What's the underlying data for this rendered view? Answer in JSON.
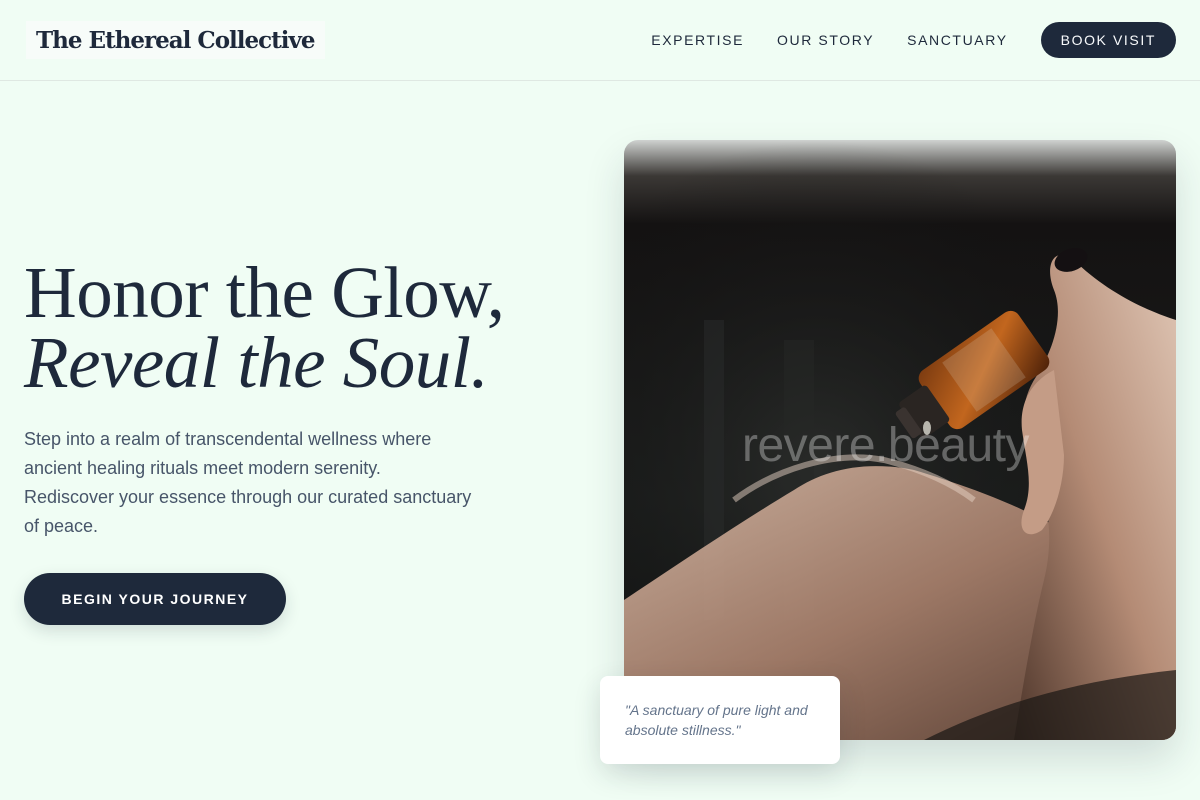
{
  "brand": {
    "name": "The Ethereal Collective"
  },
  "nav": {
    "links": [
      "EXPERTISE",
      "OUR STORY",
      "SANCTUARY"
    ],
    "cta_label": "BOOK VISIT"
  },
  "hero": {
    "headline_line1": "Honor the Glow,",
    "headline_line2": "Reveal the Soul.",
    "lead": "Step into a realm of transcendental wellness where ancient healing rituals meet modern serenity. Rediscover your essence through our curated sanctuary of peace.",
    "cta_label": "BEGIN YOUR JOURNEY"
  },
  "media": {
    "watermark": "revere.beauty",
    "image_description_icon": "hands-oil-dropper-photo"
  },
  "quote": {
    "text": "\"A sanctuary of pure light and absolute stillness.\""
  },
  "colors": {
    "background": "#f0fdf4",
    "primary": "#1e293b",
    "muted_text": "#475569",
    "quote_text": "#64748b"
  }
}
